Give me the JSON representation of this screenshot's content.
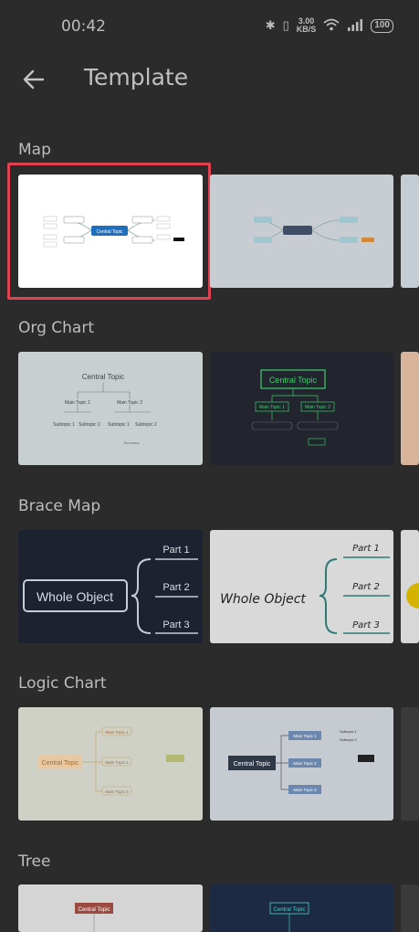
{
  "status": {
    "time": "00:42",
    "speed_value": "3.00",
    "speed_unit": "KB/S",
    "battery": "100"
  },
  "header": {
    "title": "Template"
  },
  "sections": [
    {
      "title": "Map"
    },
    {
      "title": "Org Chart"
    },
    {
      "title": "Brace Map"
    },
    {
      "title": "Logic Chart"
    },
    {
      "title": "Tree"
    }
  ],
  "org": {
    "central": "Central Topic",
    "main1": "Main Topic 1",
    "main2": "Main Topic 2",
    "sub1": "Subtopic 1",
    "sub2": "Subtopic 2",
    "summary": "Summary"
  },
  "brace": {
    "whole": "Whole Object",
    "part1": "Part 1",
    "part2": "Part 2",
    "part3": "Part 3"
  },
  "logic": {
    "central": "Central Topic",
    "main1": "Main Topic 1",
    "main2": "Main Topic 2",
    "main3": "Main Topic 3",
    "sub1": "Subtopic 1",
    "sub2": "Subtopic 2"
  },
  "tree": {
    "central": "Central Topic"
  },
  "map": {
    "central": "Central Topic"
  }
}
